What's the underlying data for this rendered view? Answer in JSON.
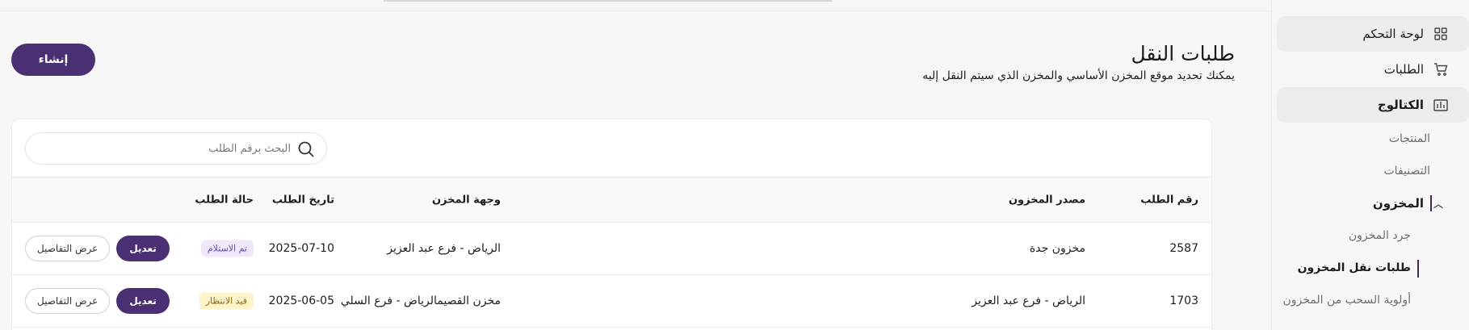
{
  "sidebar": {
    "items": [
      {
        "label": "لوحة التحكم",
        "icon": "dashboard-icon"
      },
      {
        "label": "الطلبات",
        "icon": "cart-icon"
      },
      {
        "label": "الكتالوج",
        "icon": "catalog-icon"
      }
    ],
    "catalog_children": [
      {
        "label": "المنتجات"
      },
      {
        "label": "التصنيفات"
      }
    ],
    "inventory": {
      "label": "المخزون",
      "children": [
        {
          "label": "جرد المخزون"
        },
        {
          "label": "طلبات نقل المخزون"
        },
        {
          "label": "أولوية السحب من المخزون"
        }
      ]
    }
  },
  "header": {
    "title": "طلبات النقل",
    "subtitle": "يمكنك تحديد موقع المخزن الأساسي والمخزن الذي سيتم النقل إليه",
    "create_label": "إنشاء"
  },
  "search": {
    "placeholder": "البحث برقم الطلب"
  },
  "table": {
    "columns": {
      "id": "رقم الطلب",
      "source": "مصدر المخزون",
      "destination": "وجهة المخزن",
      "date": "تاريخ الطلب",
      "status": "حالة الطلب"
    },
    "details_label": "عرض التفاصيل",
    "edit_label": "تعديل",
    "rows": [
      {
        "id": "2587",
        "source": "مخزون جدة",
        "destination": "الرياض - فرع عبد العزيز",
        "date": "2025-07-10",
        "status": "تم الاستلام"
      },
      {
        "id": "1703",
        "source": "الرياض - فرع عبد العزيز",
        "destination": "مخزن القصيمالرياض - فرع السلي",
        "date": "2025-06-05",
        "status": "قيد الانتظار"
      }
    ]
  },
  "colors": {
    "accent": "#4b2f73",
    "received_badge": "#efe8fb",
    "pending_badge": "#fff3cc"
  }
}
